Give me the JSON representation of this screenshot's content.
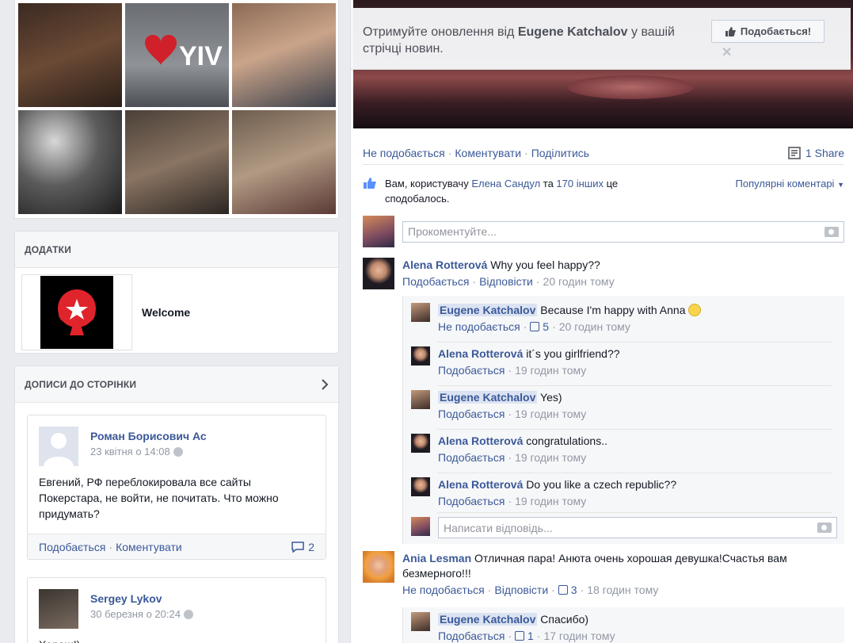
{
  "left": {
    "apps_panel": {
      "title": "ДОДАТКИ",
      "app_name": "Welcome"
    },
    "posts_panel": {
      "title": "ДОПИСИ ДО СТОРІНКИ"
    },
    "posts": [
      {
        "author": "Роман Борисович Ас",
        "time": "23 квітня о 14:08",
        "text": "Евгений, РФ переблокировала все сайты Покерстара, не войти, не почитать. Что можно придумать?",
        "like": "Подобається",
        "comment": "Коментувати",
        "comments_count": "2"
      },
      {
        "author": "Sergey Lykov",
        "time": "30 березня о 20:24",
        "text": "Хорош!)"
      }
    ]
  },
  "right": {
    "follow": {
      "text_before": "Отримуйте оновлення від ",
      "page_name": "Eugene Katchalov",
      "text_after": " у вашій стрічці новин.",
      "like_button": "Подобається!"
    },
    "actions": {
      "unlike": "Не подобається",
      "comment": "Коментувати",
      "share": "Поділитись",
      "share_count": "1 Share"
    },
    "likes": {
      "prefix": "Вам, користувачу ",
      "friend": "Елена Сандул",
      "middle": " та ",
      "others": "170 інших",
      "suffix": " це сподобалось.",
      "sort": "Популярні коментарі"
    },
    "compose_placeholder": "Прокоментуйте...",
    "comments": [
      {
        "name": "Alena Rotterová",
        "text": "Why you feel happy??",
        "like": "Подобається",
        "reply": "Відповісти",
        "time": "20 годин тому",
        "replies": [
          {
            "name": "Eugene Katchalov",
            "text": "Because I'm happy with Anna",
            "like": "Не подобається",
            "likes": "5",
            "time": "20 годин тому"
          },
          {
            "name": "Alena Rotterová",
            "text": "it´s you girlfriend??",
            "like": "Подобається",
            "time": "19 годин тому"
          },
          {
            "name": "Eugene Katchalov",
            "text": "Yes)",
            "like": "Подобається",
            "time": "19 годин тому"
          },
          {
            "name": "Alena Rotterová",
            "text": "congratulations..",
            "like": "Подобається",
            "time": "19 годин тому"
          },
          {
            "name": "Alena Rotterová",
            "text": "Do you like a czech republic??",
            "like": "Подобається",
            "time": "19 годин тому"
          }
        ],
        "reply_placeholder": "Написати відповідь..."
      },
      {
        "name": "Ania Lesman",
        "text": "Отличная пара! Анюта очень хорошая девушка!Счастья вам безмерного!!!",
        "like": "Не подобається",
        "reply": "Відповісти",
        "likes": "3",
        "time": "18 годин тому",
        "replies": [
          {
            "name": "Eugene Katchalov",
            "text": "Спасибо)",
            "like": "Подобається",
            "likes": "1",
            "time": "17 годин тому"
          }
        ]
      }
    ]
  }
}
